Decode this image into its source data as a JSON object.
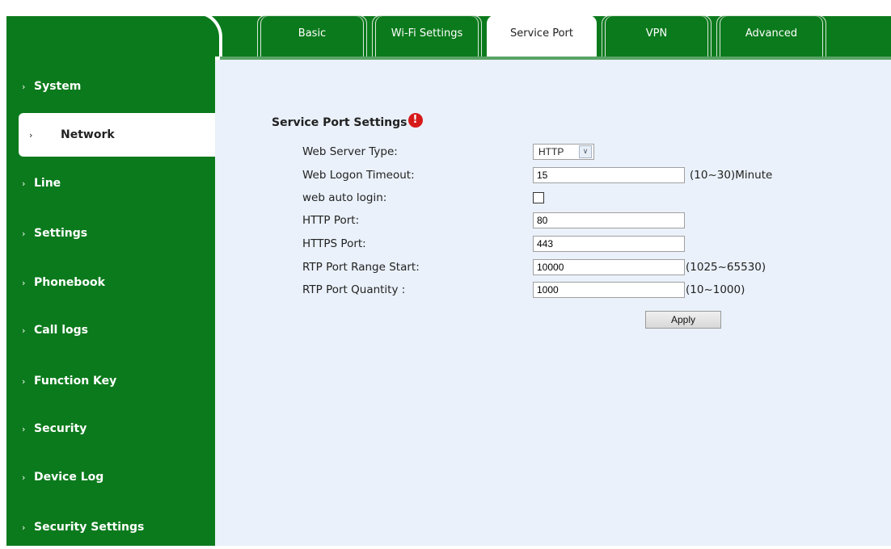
{
  "tabs": [
    "Basic",
    "Wi-Fi Settings",
    "Service Port",
    "VPN",
    "Advanced"
  ],
  "active_tab": "Service Port",
  "sidebar": {
    "items": [
      {
        "label": "System"
      },
      {
        "label": "Network"
      },
      {
        "label": "Line"
      },
      {
        "label": "Settings"
      },
      {
        "label": "Phonebook"
      },
      {
        "label": "Call logs"
      },
      {
        "label": "Function Key"
      },
      {
        "label": "Security"
      },
      {
        "label": "Device Log"
      },
      {
        "label": "Security Settings"
      }
    ],
    "chevron": "›",
    "active": "Network"
  },
  "section": {
    "title": "Service Port Settings",
    "warning_icon_text": "!"
  },
  "form": {
    "web_server_type": {
      "label": "Web Server Type:",
      "value": "HTTP"
    },
    "web_logon_timeout": {
      "label": "Web Logon Timeout:",
      "value": "15",
      "hint": "(10~30)Minute"
    },
    "web_auto_login": {
      "label": "web auto login:",
      "checked": false
    },
    "http_port": {
      "label": "HTTP Port:",
      "value": "80"
    },
    "https_port": {
      "label": "HTTPS Port:",
      "value": "443"
    },
    "rtp_port_start": {
      "label": "RTP Port Range Start:",
      "value": "10000",
      "hint": "(1025~65530)"
    },
    "rtp_port_quantity": {
      "label": "RTP Port Quantity :",
      "value": "1000",
      "hint": "(10~1000)"
    }
  },
  "apply_label": "Apply",
  "colors": {
    "brand_green": "#0b7a1c",
    "content_bg": "#eaf1fa",
    "warning_red": "#d61a1a"
  }
}
